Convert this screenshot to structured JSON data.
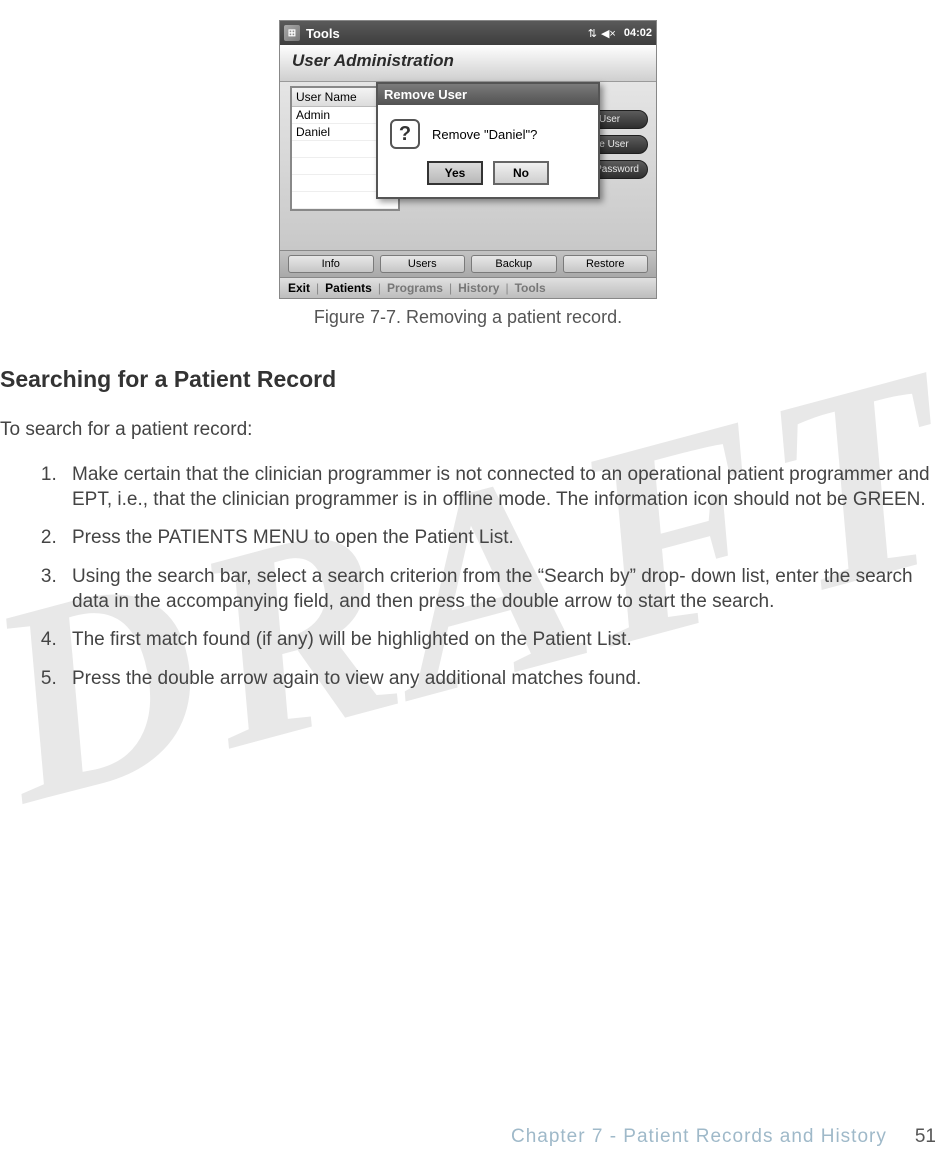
{
  "watermark": "DRAFT",
  "device": {
    "topbar": {
      "title": "Tools",
      "clock": "04:02"
    },
    "screen_title": "User Administration",
    "user_table": {
      "header": "User Name",
      "rows": [
        "Admin",
        "Daniel"
      ]
    },
    "side_buttons": [
      "New User",
      "Remove User",
      "Change Password"
    ],
    "dialog": {
      "title": "Remove User",
      "message": "Remove \"Daniel\"?",
      "yes": "Yes",
      "no": "No"
    },
    "tabs": [
      "Info",
      "Users",
      "Backup",
      "Restore"
    ],
    "bottombar": {
      "items": [
        "Exit",
        "Patients",
        "Programs",
        "History",
        "Tools"
      ],
      "active_index": 1
    }
  },
  "figure_caption": "Figure 7-7. Removing a patient record.",
  "section_heading": "Searching for a Patient Record",
  "lead_text": "To search for a patient record:",
  "steps": [
    "Make certain that the clinician programmer is not connected to an operational patient programmer and EPT, i.e., that the clinician programmer is in offline mode. The information icon should not be GREEN.",
    "Press the PATIENTS MENU to open the Patient List.",
    "Using the search bar, select a search criterion from the “Search by” drop- down list, enter the search data in the accompanying field, and then press the double arrow to start the search.",
    "The first match found (if any) will be highlighted on the Patient List.",
    "Press the double arrow again to view any additional matches found."
  ],
  "footer": {
    "chapter": "Chapter 7 - Patient Records and History",
    "page": "51"
  }
}
